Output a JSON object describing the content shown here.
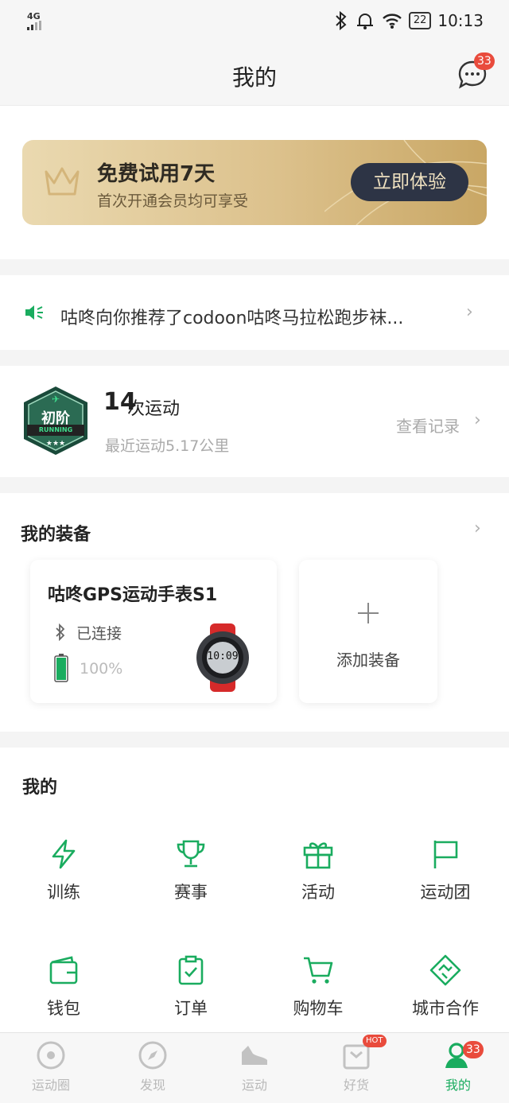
{
  "status_bar": {
    "network": "4G",
    "battery": "22",
    "time": "10:13"
  },
  "header": {
    "title": "我的",
    "message_badge": "33"
  },
  "vip": {
    "title": "免费试用7天",
    "subtitle": "首次开通会员均可享受",
    "button": "立即体验"
  },
  "notice": {
    "text": "咕咚向你推荐了codoon咕咚马拉松跑步袜..."
  },
  "stats": {
    "level_badge": "初阶",
    "level_sub": "RUNNING",
    "count": "14",
    "count_unit": "次运动",
    "recent": "最近运动5.17公里",
    "view_record": "查看记录"
  },
  "equipment": {
    "title": "我的装备",
    "device": {
      "name": "咕咚GPS运动手表S1",
      "connection": "已连接",
      "battery": "100%",
      "watch_time": "10:09"
    },
    "add_label": "添加装备"
  },
  "mine": {
    "title": "我的",
    "items": [
      {
        "label": "训练",
        "icon": "lightning-icon"
      },
      {
        "label": "赛事",
        "icon": "trophy-icon"
      },
      {
        "label": "活动",
        "icon": "gift-icon"
      },
      {
        "label": "运动团",
        "icon": "flag-icon"
      },
      {
        "label": "钱包",
        "icon": "wallet-icon"
      },
      {
        "label": "订单",
        "icon": "clipboard-check-icon"
      },
      {
        "label": "购物车",
        "icon": "cart-icon"
      },
      {
        "label": "城市合作",
        "icon": "handshake-icon"
      }
    ]
  },
  "tabbar": {
    "items": [
      {
        "label": "运动圈",
        "icon": "circle-icon"
      },
      {
        "label": "发现",
        "icon": "compass-icon"
      },
      {
        "label": "运动",
        "icon": "shoe-icon"
      },
      {
        "label": "好货",
        "icon": "shop-icon",
        "badge": "HOT"
      },
      {
        "label": "我的",
        "icon": "user-icon",
        "badge": "33"
      }
    ],
    "active": "我的"
  },
  "colors": {
    "accent": "#1aac5f",
    "badge": "#e94b3c",
    "vip_button": "#2d3445"
  }
}
